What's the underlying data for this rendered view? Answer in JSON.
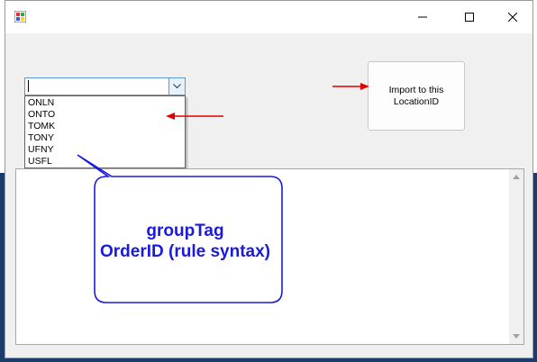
{
  "combo": {
    "value": "",
    "options": [
      "ONLN",
      "ONTO",
      "TOMK",
      "TONY",
      "UFNY",
      "USFL"
    ]
  },
  "import_button": {
    "line1": "Import to this",
    "line2": "LocationID"
  },
  "callout": {
    "line1": "groupTag",
    "line2": "OrderID (rule syntax)"
  },
  "colors": {
    "annotation_arrow": "#e00000",
    "callout_border": "#1a1adc",
    "focus_border": "#5b9bd5"
  },
  "icons": {
    "app": "app-icon",
    "minimize": "minimize-icon",
    "maximize": "maximize-icon",
    "close": "close-icon",
    "dropdown": "chevron-down-icon"
  }
}
